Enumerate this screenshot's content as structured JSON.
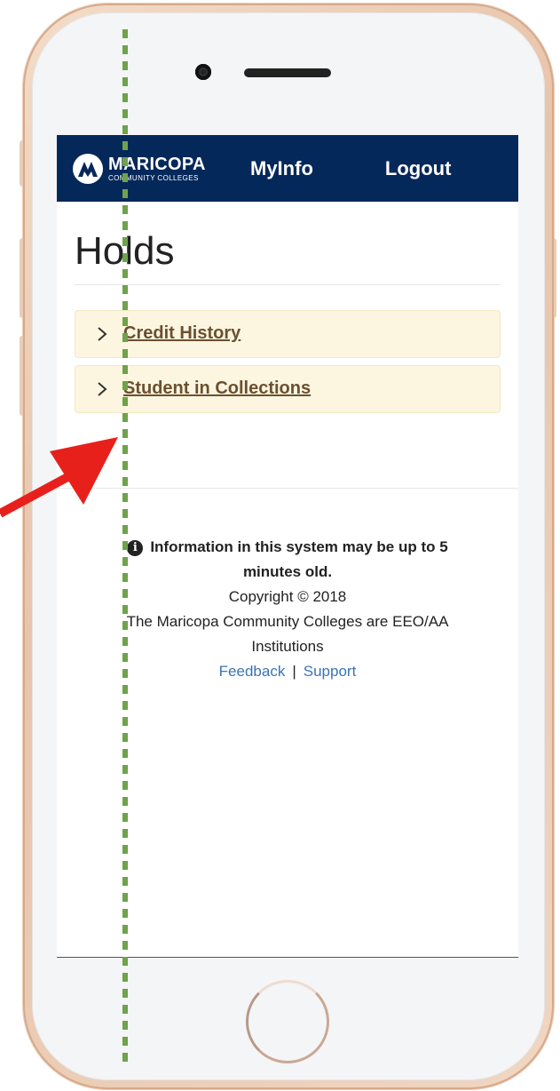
{
  "brand": {
    "name": "MARICOPA",
    "subtitle": "COMMUNITY COLLEGES"
  },
  "nav": {
    "myinfo": "MyInfo",
    "logout": "Logout"
  },
  "page": {
    "title": "Holds"
  },
  "holds": [
    {
      "label": "Credit History"
    },
    {
      "label": "Student in Collections"
    }
  ],
  "footer": {
    "notice": "Information in this system may be up to 5 minutes old.",
    "copyright": "Copyright © 2018",
    "eeo": "The Maricopa Community Colleges are EEO/AA Institutions",
    "feedback": "Feedback",
    "separator": "|",
    "support": "Support"
  },
  "colors": {
    "navbar": "#05285a",
    "hold_background": "#fcf6e1",
    "hold_link": "#6b5030",
    "footer_link": "#3a74b3",
    "annotation_arrow": "#e8201c",
    "annotation_dashes": "#6fa24a",
    "phone_frame": "#e8c4aa"
  },
  "icons": {
    "brand": "maricopa-logo-icon",
    "hold_expand": "chevron-right-icon",
    "notice": "info-circle-icon"
  }
}
